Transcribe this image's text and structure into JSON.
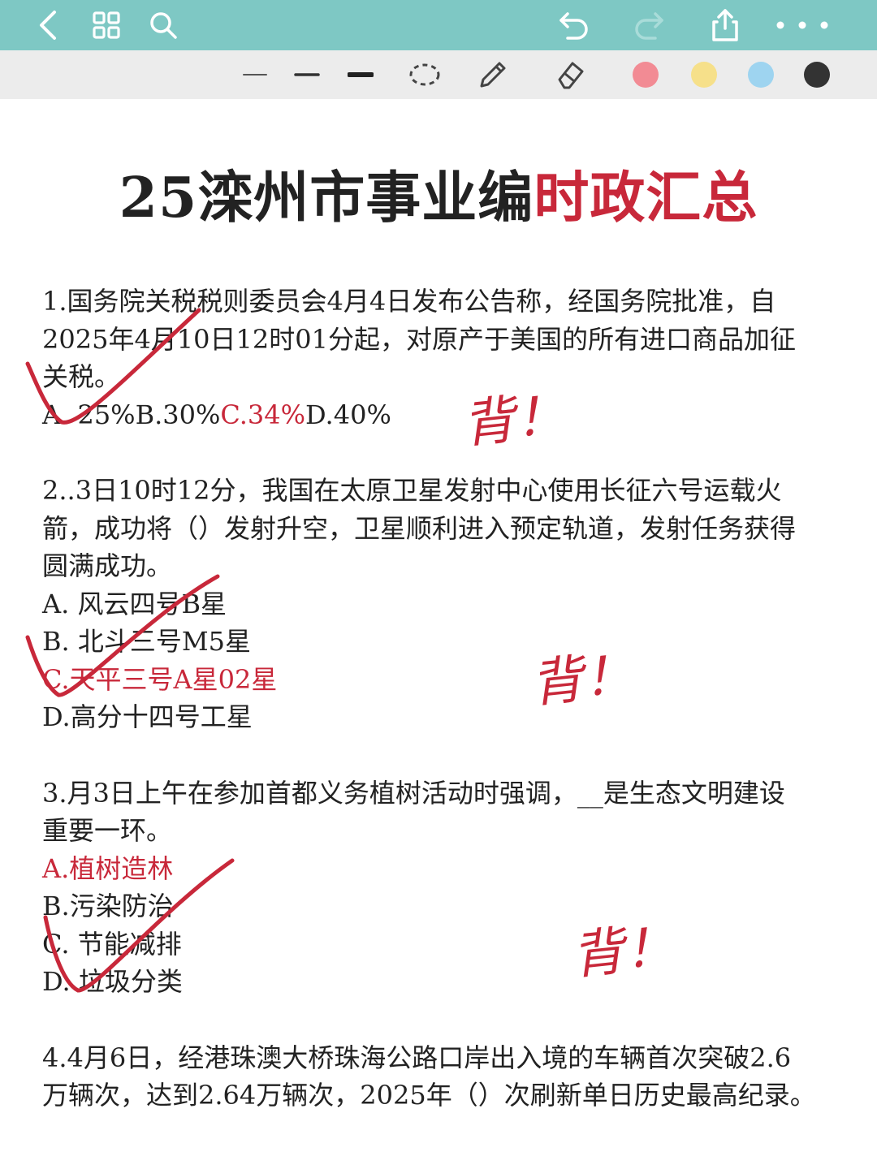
{
  "colors": {
    "top_bar": "#7ec8c4",
    "tool_bar": "#ececec",
    "accent_red": "#c8283a",
    "pen_pink": "#f28b94",
    "pen_yellow": "#f6e08a",
    "pen_blue": "#9ed4f0",
    "pen_black": "#333333"
  },
  "top_bar": {
    "icons": [
      "back-icon",
      "grid-icon",
      "search-icon",
      "undo-icon",
      "redo-icon",
      "share-icon",
      "more-icon"
    ]
  },
  "tool_bar": {
    "tools": [
      "pen-thin-icon",
      "pen-medium-icon",
      "pen-thick-icon",
      "lasso-icon",
      "pencil-icon",
      "eraser-icon"
    ],
    "color_swatches": [
      "pink",
      "yellow",
      "blue",
      "black"
    ]
  },
  "document": {
    "title_main": "25滦州市事业编",
    "title_accent": "时政汇总",
    "questions": [
      {
        "lines": [
          "1.国务院关税税则委员会4月4日发布公告称，经国务院批准，自",
          "2025年4月10日12时01分起，对原产于美国的所有进口商品加征",
          "关税。"
        ],
        "options_inline": [
          {
            "text": "A. 25%",
            "highlight": false
          },
          {
            "text": "B.30%",
            "highlight": false
          },
          {
            "text": "C.34%",
            "highlight": true
          },
          {
            "text": "D.40%",
            "highlight": false
          }
        ]
      },
      {
        "lines": [
          "2..3日10时12分，我国在太原卫星发射中心使用长征六号运载火",
          "箭，成功将（）发射升空，卫星顺利进入预定轨道，发射任务获得",
          "圆满成功。"
        ],
        "options": [
          {
            "text": "A. 风云四号B星",
            "highlight": false
          },
          {
            "text": "B. 北斗三号M5星",
            "highlight": false
          },
          {
            "text": "C.天平三号A星02星",
            "highlight": true
          },
          {
            "text": "D.高分十四号工星",
            "highlight": false
          }
        ]
      },
      {
        "lines": [
          "3.月3日上午在参加首都义务植树活动时强调，__是生态文明建设",
          "重要一环。"
        ],
        "options": [
          {
            "text": "A.植树造林",
            "highlight": true
          },
          {
            "text": "B.污染防治",
            "highlight": false
          },
          {
            "text": "C. 节能减排",
            "highlight": false
          },
          {
            "text": "D. 垃圾分类",
            "highlight": false
          }
        ]
      },
      {
        "lines": [
          "4.4月6日，经港珠澳大桥珠海公路口岸出入境的车辆首次突破2.6",
          "万辆次，达到2.64万辆次，2025年（）次刷新单日历史最高纪录。"
        ]
      }
    ],
    "handwritten_notes": [
      "背！",
      "背！",
      "背！"
    ]
  }
}
